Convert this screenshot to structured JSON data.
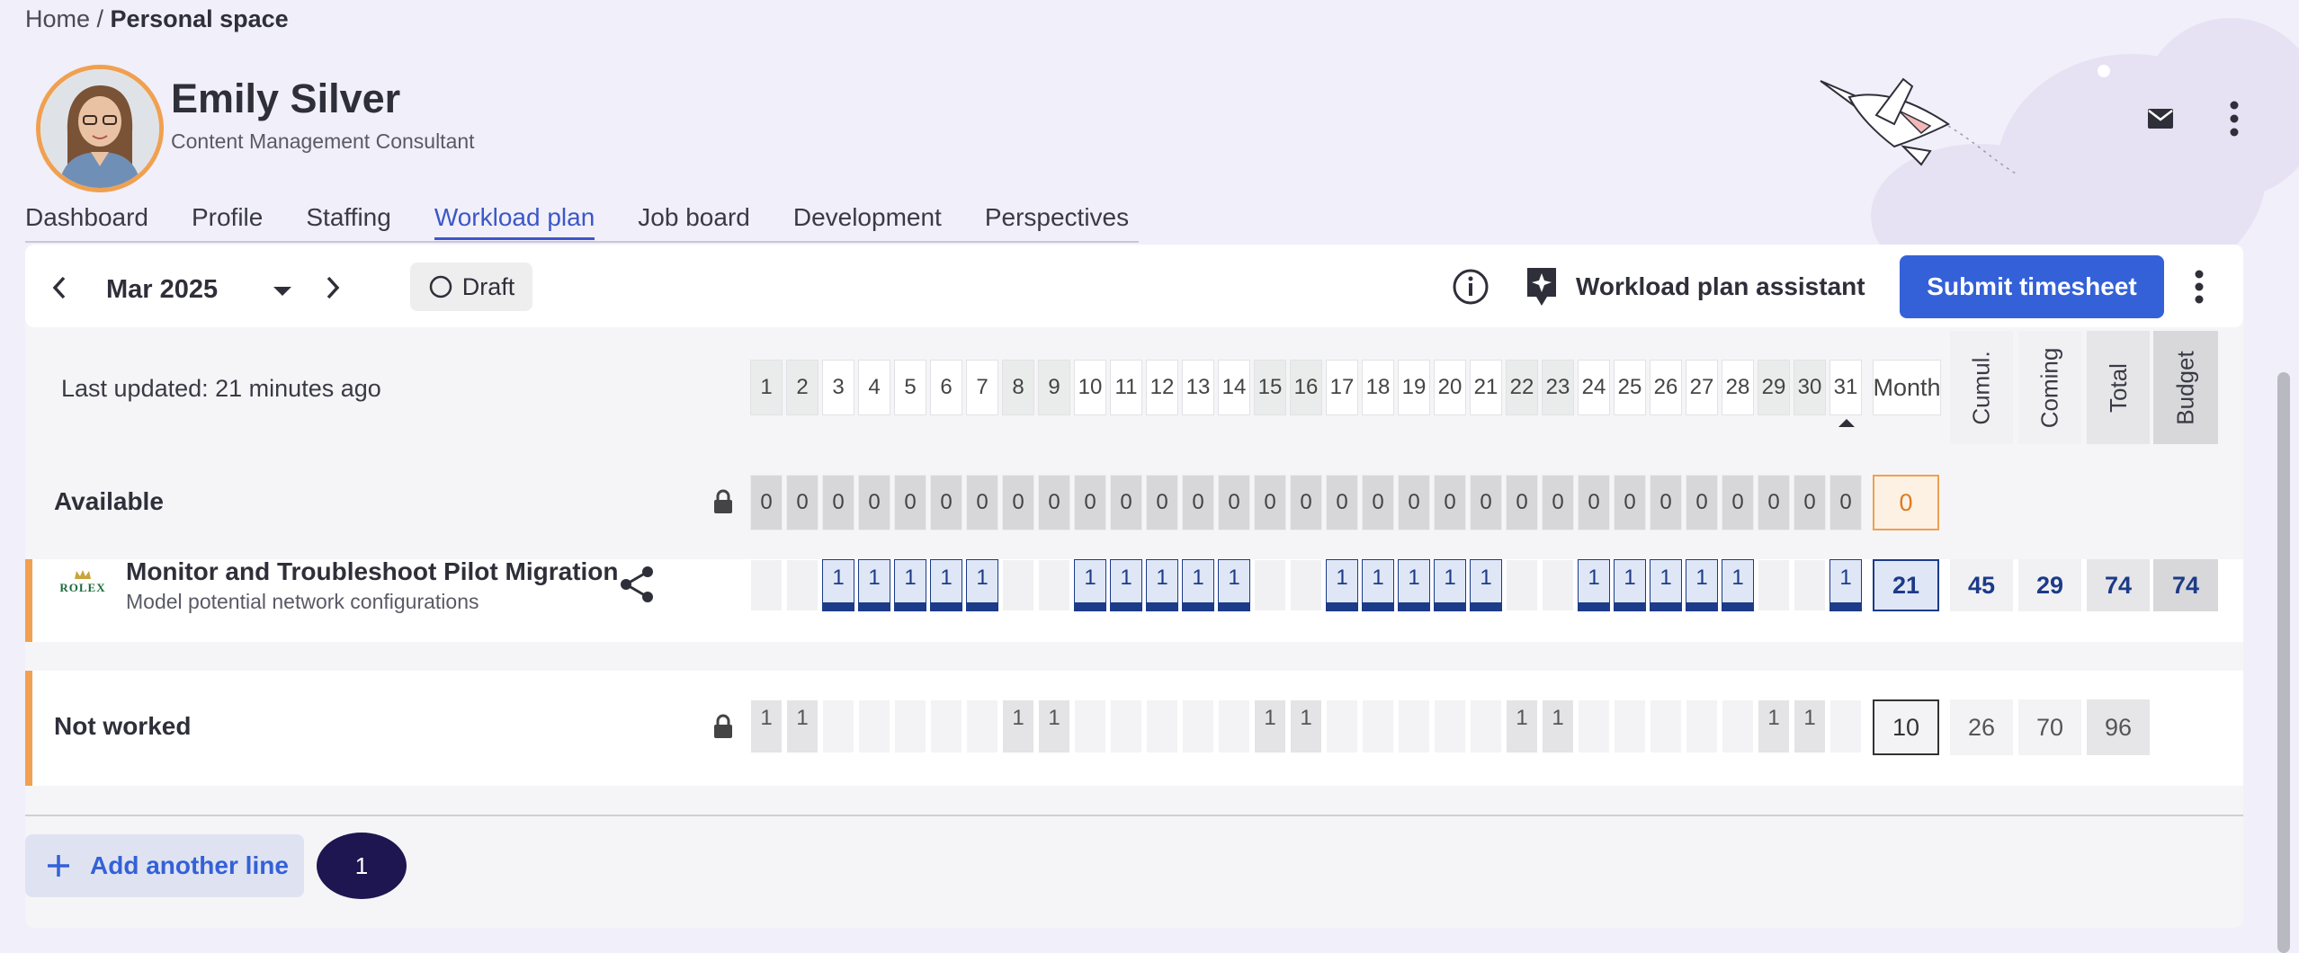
{
  "breadcrumb": {
    "home": "Home",
    "separator": " / ",
    "current": "Personal space"
  },
  "user": {
    "name": "Emily Silver",
    "role": "Content Management Consultant"
  },
  "header_icons": [
    "mail-icon",
    "more-vert-icon"
  ],
  "tabs": [
    {
      "label": "Dashboard",
      "active": false
    },
    {
      "label": "Profile",
      "active": false
    },
    {
      "label": "Staffing",
      "active": false
    },
    {
      "label": "Workload plan",
      "active": true
    },
    {
      "label": "Job board",
      "active": false
    },
    {
      "label": "Development",
      "active": false
    },
    {
      "label": "Perspectives",
      "active": false
    }
  ],
  "toolbar": {
    "month": "Mar 2025",
    "status": "Draft",
    "assistant_label": "Workload plan assistant",
    "submit_label": "Submit timesheet"
  },
  "grid": {
    "last_updated": "Last updated: 21 minutes ago",
    "days": [
      "1",
      "2",
      "3",
      "4",
      "5",
      "6",
      "7",
      "8",
      "9",
      "10",
      "11",
      "12",
      "13",
      "14",
      "15",
      "16",
      "17",
      "18",
      "19",
      "20",
      "21",
      "22",
      "23",
      "24",
      "25",
      "26",
      "27",
      "28",
      "29",
      "30",
      "31"
    ],
    "weekend_days": [
      1,
      2,
      8,
      9,
      15,
      16,
      22,
      23,
      29,
      30
    ],
    "month_label": "Month",
    "summary_headers": [
      "Cumul.",
      "Coming",
      "Total",
      "Budget"
    ]
  },
  "available": {
    "label": "Available",
    "values": [
      "0",
      "0",
      "0",
      "0",
      "0",
      "0",
      "0",
      "0",
      "0",
      "0",
      "0",
      "0",
      "0",
      "0",
      "0",
      "0",
      "0",
      "0",
      "0",
      "0",
      "0",
      "0",
      "0",
      "0",
      "0",
      "0",
      "0",
      "0",
      "0",
      "0",
      "0"
    ],
    "month": "0"
  },
  "task": {
    "logo_text": "ROLEX",
    "title": "Monitor and Troubleshoot Pilot Migration",
    "subtitle": "Model potential network configurations",
    "days": [
      "",
      "",
      "1",
      "1",
      "1",
      "1",
      "1",
      "",
      "",
      "1",
      "1",
      "1",
      "1",
      "1",
      "",
      "",
      "1",
      "1",
      "1",
      "1",
      "1",
      "",
      "",
      "1",
      "1",
      "1",
      "1",
      "1",
      "",
      "",
      "1"
    ],
    "month": "21",
    "cumul": "45",
    "coming": "29",
    "total": "74",
    "budget": "74"
  },
  "not_worked": {
    "label": "Not worked",
    "days": [
      "1",
      "1",
      "",
      "",
      "",
      "",
      "",
      "1",
      "1",
      "",
      "",
      "",
      "",
      "",
      "1",
      "1",
      "",
      "",
      "",
      "",
      "",
      "1",
      "1",
      "",
      "",
      "",
      "",
      "",
      "1",
      "1",
      ""
    ],
    "month": "10",
    "cumul": "26",
    "coming": "70",
    "total": "96"
  },
  "footer": {
    "add_line_label": "Add another line",
    "badge_count": "1"
  },
  "colors": {
    "accent": "#3461d8",
    "navy": "#1c3b88",
    "orange": "#f0a050",
    "badge": "#1e1650"
  }
}
